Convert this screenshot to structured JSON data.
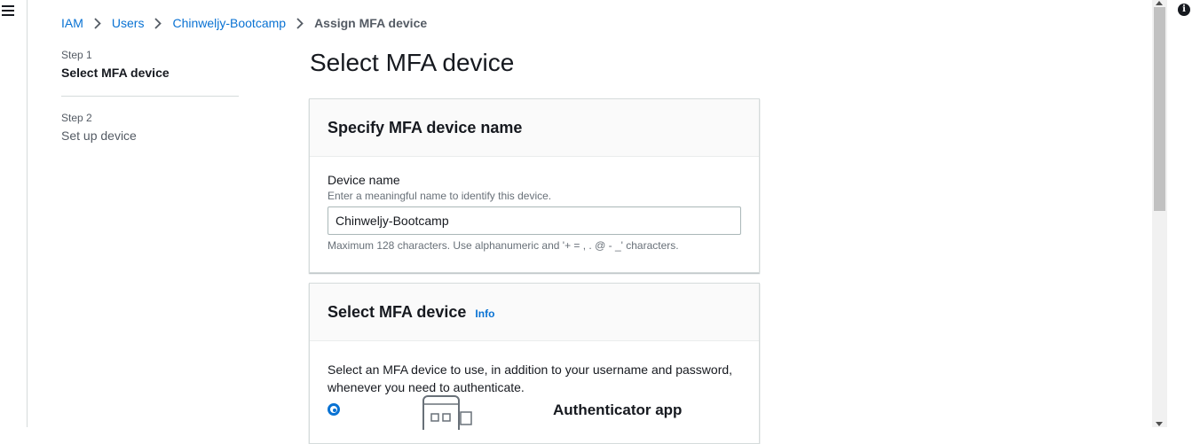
{
  "breadcrumb": {
    "items": [
      "IAM",
      "Users",
      "Chinweljy-Bootcamp"
    ],
    "current": "Assign MFA device"
  },
  "steps": [
    {
      "label": "Step 1",
      "title": "Select MFA device"
    },
    {
      "label": "Step 2",
      "title": "Set up device"
    }
  ],
  "page_title": "Select MFA device",
  "device_name_panel": {
    "header": "Specify MFA device name",
    "field_label": "Device name",
    "field_description": "Enter a meaningful name to identify this device.",
    "field_value": "Chinweljy-Bootcamp",
    "constraint": "Maximum 128 characters. Use alphanumeric and '+ = , . @ - _' characters."
  },
  "select_device_panel": {
    "header": "Select MFA device",
    "info_link": "Info",
    "description": "Select an MFA device to use, in addition to your username and password, whenever you need to authenticate.",
    "options": [
      {
        "title": "Authenticator app",
        "selected": true,
        "icon": "phone-qr-icon"
      }
    ]
  },
  "icons": {
    "menu": "hamburger-menu-icon",
    "info": "info-icon",
    "breadcrumb_separator": "chevron-right-icon"
  },
  "colors": {
    "link": "#0972d3",
    "text": "#16191f",
    "muted": "#545b64"
  }
}
